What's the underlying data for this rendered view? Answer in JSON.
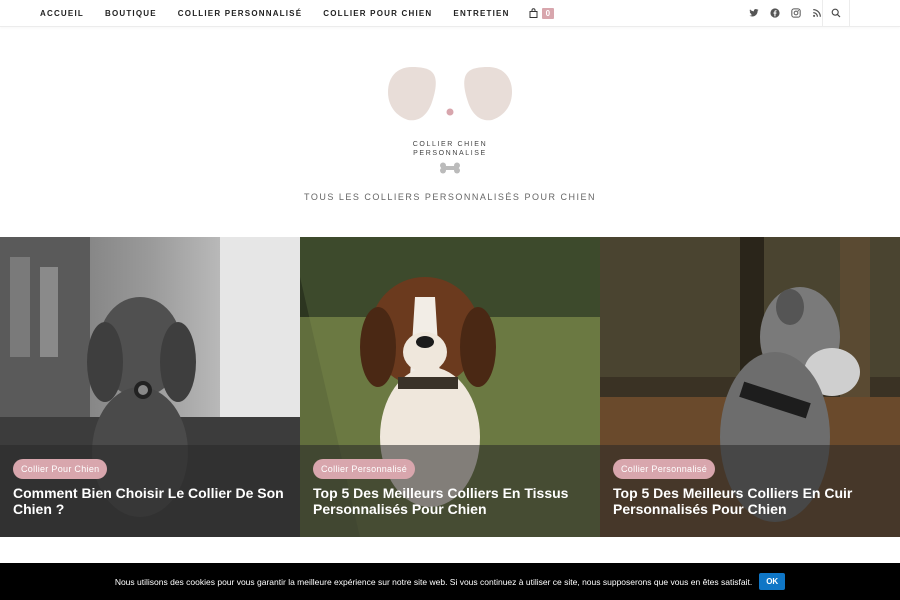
{
  "nav": {
    "items": [
      {
        "label": "ACCUEIL"
      },
      {
        "label": "BOUTIQUE"
      },
      {
        "label": "COLLIER PERSONNALISÉ"
      },
      {
        "label": "COLLIER POUR CHIEN"
      },
      {
        "label": "ENTRETIEN"
      }
    ],
    "cart_count": "0"
  },
  "site": {
    "logo_line1": "COLLIER CHIEN",
    "logo_line2": "PERSONNALISE",
    "tagline": "TOUS LES COLLIERS PERSONNALISÉS POUR CHIEN"
  },
  "posts": [
    {
      "category": "Collier Pour Chien",
      "title": "Comment Bien Choisir Le Collier De Son Chien ?"
    },
    {
      "category": "Collier Personnalisé",
      "title": "Top 5 Des Meilleurs Colliers En Tissus Personnalisés Pour Chien"
    },
    {
      "category": "Collier Personnalisé",
      "title": "Top 5 Des Meilleurs Colliers En Cuir Personnalisés Pour Chien"
    }
  ],
  "cookie": {
    "text": "Nous utilisons des cookies pour vous garantir la meilleure expérience sur notre site web. Si vous continuez à utiliser ce site, nous supposerons que vous en êtes satisfait.",
    "ok_label": "OK"
  },
  "colors": {
    "accent": "#d8a6ad",
    "cookie_button": "#0f76c6",
    "logo_ears": "#e8ddd8"
  }
}
